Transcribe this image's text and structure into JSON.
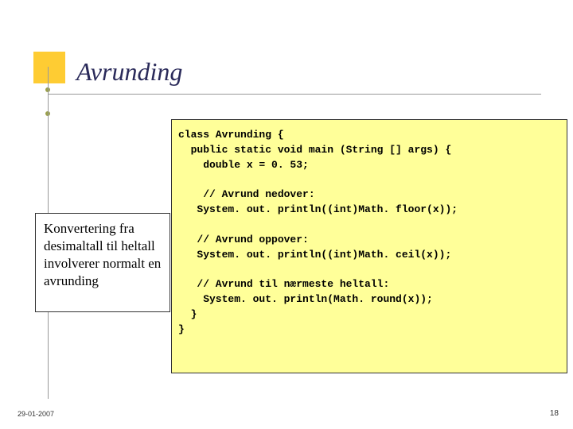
{
  "title": "Avrunding",
  "textbox": "Konvertering fra desimaltall til heltall involverer normalt en avrunding",
  "code": {
    "l1": "class Avrunding {",
    "l2": "  public static void main (String [] args) {",
    "l3": "    double x = 0. 53;",
    "l4": "",
    "l5": "    // Avrund nedover:",
    "l6": "   System. out. println((int)Math. floor(x));",
    "l7": "",
    "l8": "   // Avrund oppover:",
    "l9": "   System. out. println((int)Math. ceil(x));",
    "l10": "",
    "l11": "   // Avrund til nærmeste heltall:",
    "l12": "    System. out. println(Math. round(x));",
    "l13": "  }",
    "l14": "}"
  },
  "footer": {
    "date": "29-01-2007",
    "page": "18"
  }
}
